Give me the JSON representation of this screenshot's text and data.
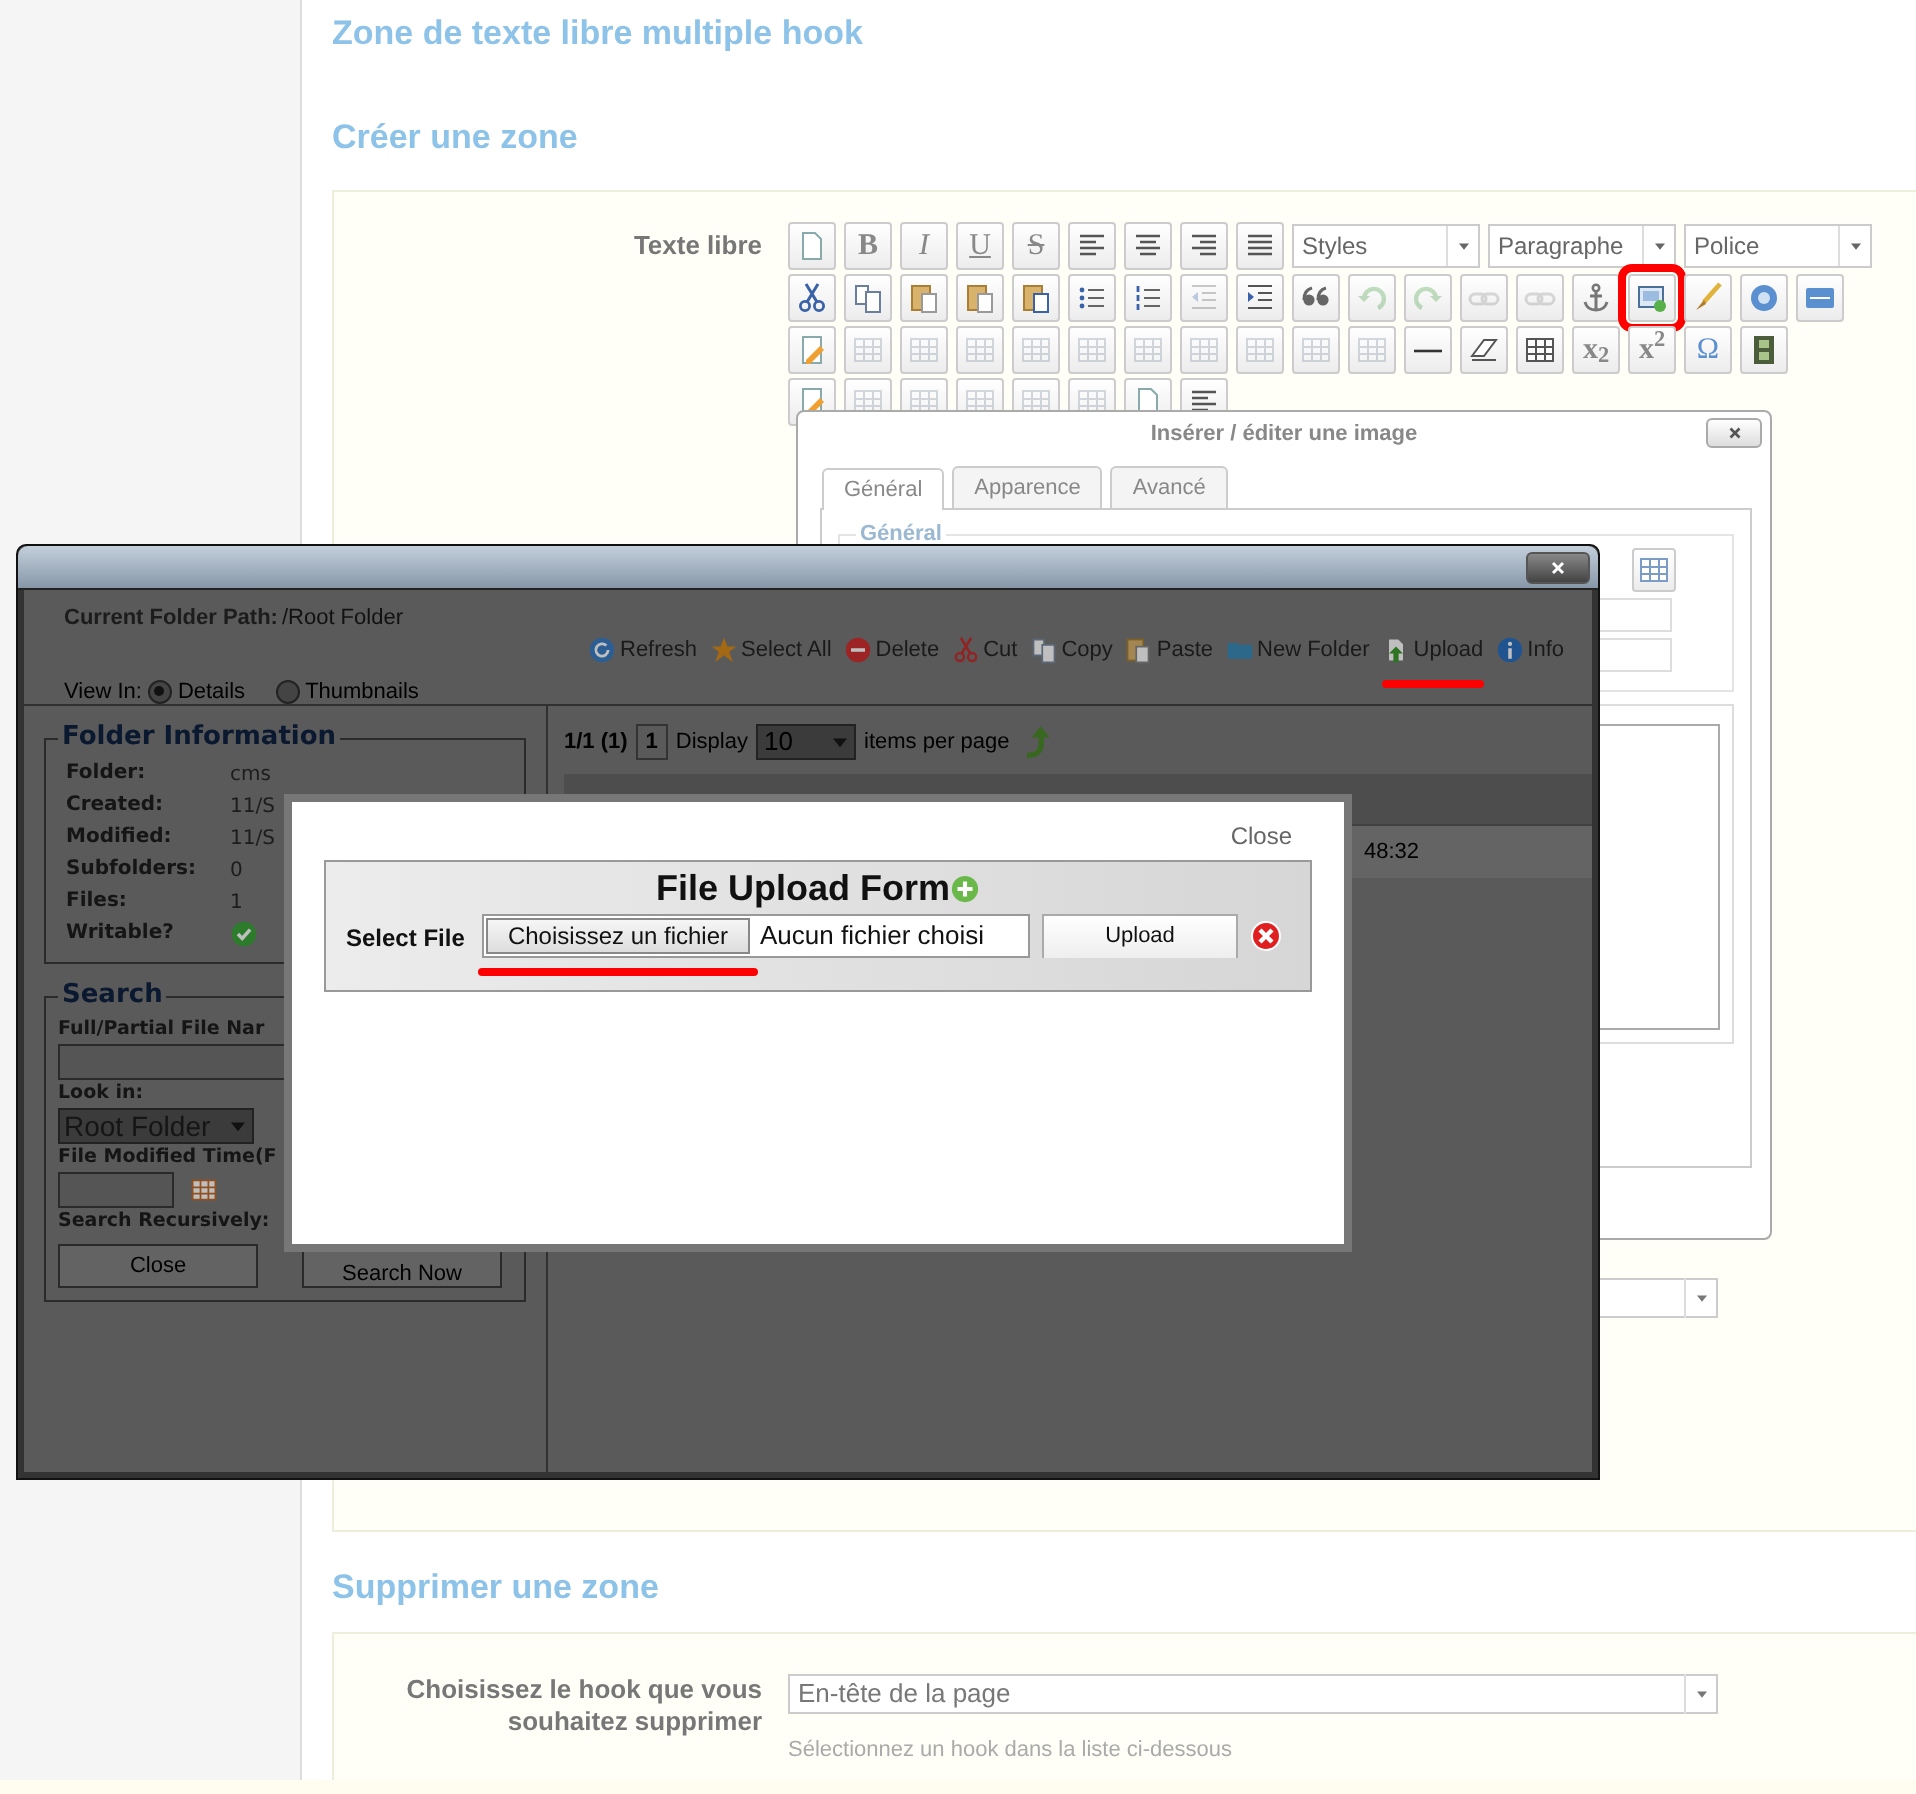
{
  "page_title": "Zone de texte libre multiple hook",
  "create_section": {
    "title": "Créer une zone",
    "field_label": "Texte libre",
    "editor_toolbar": [
      [
        {
          "kind": "icon",
          "disabled": false
        },
        {
          "kind": "glyph",
          "text": "B"
        },
        {
          "kind": "glyph",
          "text": "I"
        },
        {
          "kind": "glyph",
          "text": "U"
        },
        {
          "kind": "glyph",
          "text": "S"
        },
        {
          "kind": "icon",
          "disabled": false
        },
        {
          "kind": "icon",
          "disabled": false
        },
        {
          "kind": "icon",
          "disabled": false
        },
        {
          "kind": "icon",
          "disabled": false
        },
        {
          "kind": "select",
          "value": "Styles"
        },
        {
          "kind": "select",
          "value": "Paragraphe"
        },
        {
          "kind": "select",
          "value": "Police"
        }
      ],
      [
        {
          "kind": "icon",
          "disabled": false
        },
        {
          "kind": "icon",
          "disabled": false
        },
        {
          "kind": "icon",
          "disabled": false
        },
        {
          "kind": "icon",
          "disabled": false
        },
        {
          "kind": "icon",
          "disabled": false
        },
        {
          "kind": "icon",
          "disabled": false
        },
        {
          "kind": "icon",
          "disabled": false
        },
        {
          "kind": "icon",
          "disabled": true
        },
        {
          "kind": "icon",
          "disabled": false
        },
        {
          "kind": "icon",
          "disabled": false
        },
        {
          "kind": "icon",
          "disabled": true
        },
        {
          "kind": "icon",
          "disabled": true
        },
        {
          "kind": "icon",
          "disabled": true
        },
        {
          "kind": "icon",
          "disabled": true
        },
        {
          "kind": "icon",
          "disabled": false
        },
        {
          "kind": "icon",
          "disabled": false,
          "highlighted": true
        },
        {
          "kind": "icon",
          "disabled": false
        },
        {
          "kind": "icon",
          "disabled": false
        },
        {
          "kind": "icon",
          "disabled": false
        }
      ],
      [
        {
          "kind": "icon",
          "disabled": false
        },
        {
          "kind": "icon",
          "disabled": true
        },
        {
          "kind": "icon",
          "disabled": true
        },
        {
          "kind": "icon",
          "disabled": true
        },
        {
          "kind": "icon",
          "disabled": true
        },
        {
          "kind": "icon",
          "disabled": true
        },
        {
          "kind": "icon",
          "disabled": true
        },
        {
          "kind": "icon",
          "disabled": true
        },
        {
          "kind": "icon",
          "disabled": true
        },
        {
          "kind": "icon",
          "disabled": true
        },
        {
          "kind": "icon",
          "disabled": true
        },
        {
          "kind": "icon",
          "disabled": false
        },
        {
          "kind": "icon",
          "disabled": false
        },
        {
          "kind": "icon",
          "disabled": false
        },
        {
          "kind": "glyph",
          "text": "x$_{2}$"
        },
        {
          "kind": "glyph",
          "text": "x$^{2}$"
        },
        {
          "kind": "glyph",
          "text": "Ω"
        },
        {
          "kind": "icon",
          "disabled": false
        }
      ],
      [
        {
          "kind": "icon",
          "disabled": false
        },
        {
          "kind": "icon",
          "disabled": true
        },
        {
          "kind": "icon",
          "disabled": true
        },
        {
          "kind": "icon",
          "disabled": true
        },
        {
          "kind": "icon",
          "disabled": true
        },
        {
          "kind": "icon",
          "disabled": true
        },
        {
          "kind": "icon",
          "disabled": false
        },
        {
          "kind": "icon",
          "disabled": false
        }
      ]
    ]
  },
  "image_dialog": {
    "title": "Insérer / éditer une image",
    "tabs": [
      {
        "label": "Général",
        "selected": true
      },
      {
        "label": "Apparence",
        "selected": false
      },
      {
        "label": "Avancé",
        "selected": false
      }
    ],
    "legend": "Général"
  },
  "file_manager": {
    "path_label": "Current Folder Path:",
    "path": "/Root Folder",
    "view_label": "View In:",
    "view_options": [
      {
        "label": "Details",
        "selected": true
      },
      {
        "label": "Thumbnails",
        "selected": false
      }
    ],
    "toolbar": [
      {
        "label": "Refresh",
        "underlined": false
      },
      {
        "label": "Select All",
        "underlined": false
      },
      {
        "label": "Delete",
        "underlined": false
      },
      {
        "label": "Cut",
        "underlined": false
      },
      {
        "label": "Copy",
        "underlined": false
      },
      {
        "label": "Paste",
        "underlined": false
      },
      {
        "label": "New Folder",
        "underlined": false
      },
      {
        "label": "Upload",
        "underlined": true
      },
      {
        "label": "Info",
        "underlined": false
      }
    ],
    "folder_info": {
      "legend": "Folder Information",
      "rows": [
        {
          "kind": "text",
          "label": "Folder:",
          "value": "cms"
        },
        {
          "kind": "text",
          "label": "Created:",
          "value": "11/S"
        },
        {
          "kind": "text",
          "label": "Modified:",
          "value": "11/S"
        },
        {
          "kind": "text",
          "label": "Subfolders:",
          "value": "0"
        },
        {
          "kind": "text",
          "label": "Files:",
          "value": "1"
        },
        {
          "kind": "check",
          "label": "Writable?"
        }
      ]
    },
    "search": {
      "legend": "Search",
      "name_label": "Full/Partial File Nar",
      "look_in_label": "Look in:",
      "look_in_value": "Root Folder",
      "time_label": "File Modified Time(F",
      "recursive_label": "Search Recursively:",
      "buttons": [
        "Close",
        "Search Now"
      ]
    },
    "pager": {
      "summary": "1/1 (1)",
      "page": "1",
      "display_label": "Display",
      "per_page": "10",
      "per_page_label": "items per page"
    },
    "row_time": "48:32"
  },
  "upload_form": {
    "close": "Close",
    "title": "File Upload Form",
    "select_label": "Select File",
    "choose_button": "Choisissez un fichier",
    "choose_underlined": true,
    "file_status": "Aucun fichier choisi",
    "upload_button": "Upload"
  },
  "delete_section": {
    "title": "Supprimer une zone",
    "field_label": "Choisissez le hook que vous souhaitez supprimer",
    "select_value": "En-tête de la page",
    "hint": "Sélectionnez un hook dans la liste ci-dessous"
  }
}
